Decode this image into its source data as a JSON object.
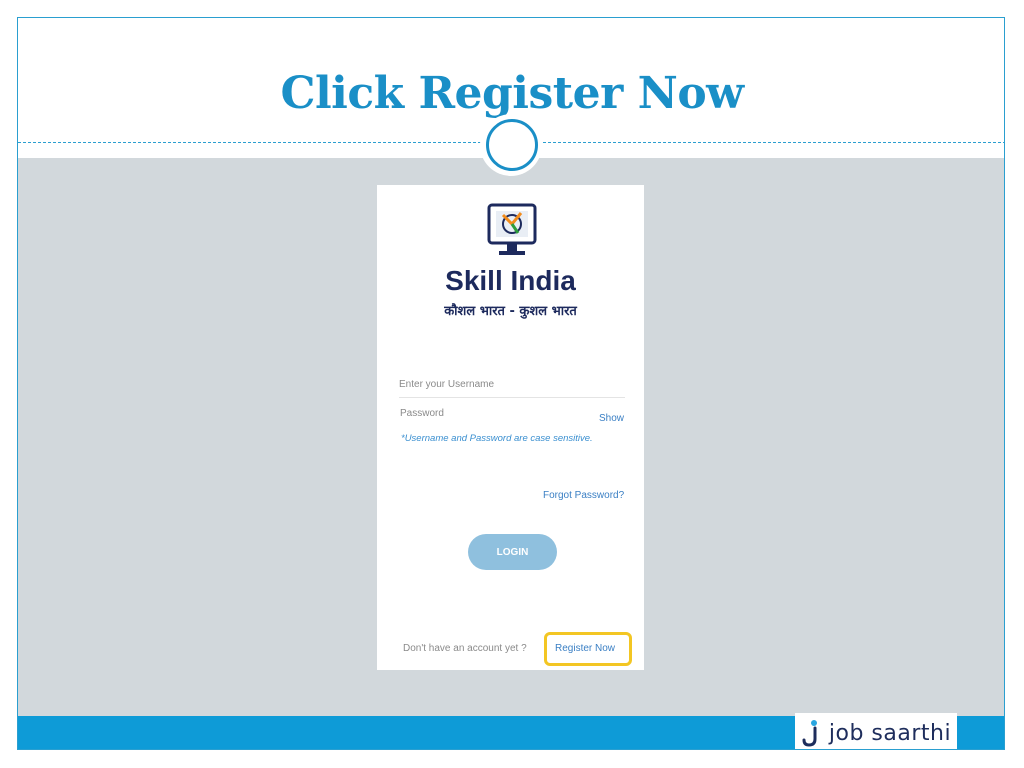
{
  "slide": {
    "title": "Click Register Now"
  },
  "login_card": {
    "brand": "Skill India",
    "tagline": "कौशल भारत - कुशल भारत",
    "username_placeholder": "Enter your Username",
    "password_label": "Password",
    "show_label": "Show",
    "case_hint": "*Username and Password are case sensitive.",
    "forgot_label": "Forgot Password?",
    "login_label": "LOGIN",
    "no_account_text": "Don't have an account yet ?",
    "register_label": "Register Now"
  },
  "footer": {
    "badge_text": "job saarthi"
  },
  "colors": {
    "accent": "#1a8fc7",
    "bottom_bar": "#0e9bd7",
    "grey_area": "#d2d8dc",
    "highlight": "#f3c623",
    "login_button": "#8fc0de",
    "brand_navy": "#1d2a5d"
  },
  "icons": {
    "logo": "skill-india-monitor-logo",
    "badge": "job-saarthi-mark"
  }
}
